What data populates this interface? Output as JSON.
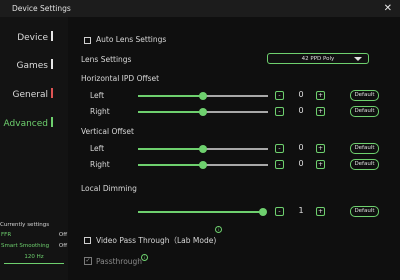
{
  "window": {
    "title": "Device Settings",
    "close_glyph": "✕"
  },
  "sidebar": {
    "items": [
      {
        "label": "Device",
        "state": "normal"
      },
      {
        "label": "Games",
        "state": "normal"
      },
      {
        "label": "General",
        "state": "warning"
      },
      {
        "label": "Advanced",
        "state": "active"
      }
    ]
  },
  "current_settings": {
    "title": "Currently settings",
    "rows": [
      {
        "key": "FFR",
        "value": "Off"
      },
      {
        "key": "Smart Smoothing",
        "value": "Off"
      }
    ],
    "refresh": "120 Hz"
  },
  "auto_lens": {
    "label": "Auto Lens Settings",
    "checked": false
  },
  "lens": {
    "label": "Lens Settings",
    "selected": "42 PPD Poly"
  },
  "ipd": {
    "title": "Horizontal IPD Offset",
    "rows": [
      {
        "label": "Left",
        "value": "0",
        "level": 0.5
      },
      {
        "label": "Right",
        "value": "0",
        "level": 0.5
      }
    ]
  },
  "vertical": {
    "title": "Vertical Offset",
    "rows": [
      {
        "label": "Left",
        "value": "0",
        "level": 0.5
      },
      {
        "label": "Right",
        "value": "0",
        "level": 0.5
      }
    ]
  },
  "dimming": {
    "title": "Local Dimming",
    "value": "1",
    "level": 1.0
  },
  "controls": {
    "minus": "-",
    "plus": "+",
    "default": "Default"
  },
  "passthrough_video": {
    "label": "Video Pass Through（Lab Mode)",
    "checked": false
  },
  "passthrough": {
    "label": "Passthrough",
    "checked": true,
    "enabled": false
  },
  "colors": {
    "accent": "#6ed06e",
    "warning": "#e05454",
    "background": "#0f0f0f"
  }
}
